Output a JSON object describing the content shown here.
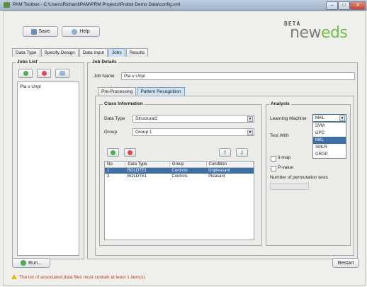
{
  "window": {
    "title": "PAM Toolbox - C:\\Users\\Richard\\PAM\\PRM Projects\\Probol Demo Data\\config.xml",
    "minimize_glyph": "–",
    "maximize_glyph": "□",
    "close_glyph": "✕"
  },
  "toolbar": {
    "save_label": "Save",
    "help_label": "Help"
  },
  "logo": {
    "beta": "BETA",
    "new": "new",
    "eds": "eds"
  },
  "tabs": [
    {
      "label": "Data Type"
    },
    {
      "label": "Specify Design"
    },
    {
      "label": "Data Input"
    },
    {
      "label": "Jobs"
    },
    {
      "label": "Results"
    }
  ],
  "jobs_list": {
    "title": "Jobs List",
    "items": [
      "Pla v Unpl"
    ]
  },
  "job_details": {
    "title": "Job Details",
    "job_name_label": "Job Name",
    "job_name_value": "Pla v Unpl",
    "subtabs": [
      {
        "label": "Pre-Processing"
      },
      {
        "label": "Pattern Recognition"
      }
    ]
  },
  "class_info": {
    "title": "Class Information",
    "data_type_label": "Data Type",
    "data_type_value": "Structural2",
    "group_label": "Group",
    "group_value": "Group 1",
    "columns": [
      "No.",
      "Data Type",
      "Group",
      "Condition"
    ],
    "rows": [
      [
        "1",
        "BOLDTE1",
        "Controls",
        "Unpleasant"
      ],
      [
        "2",
        "BOLDTE1",
        "Controls",
        "Pleasant"
      ]
    ],
    "up_glyph": "⇧",
    "down_glyph": "⇩"
  },
  "analysis": {
    "title": "Analysis",
    "learning_machine_label": "Learning Machine",
    "learning_machine_value": "MKL",
    "options": [
      "SVM",
      "GPC",
      "MKL",
      "SMLR",
      "GRGP"
    ],
    "selected_option": "MKL",
    "test_with_label": "Test With",
    "checkbox_map": "Ii-map",
    "checkbox_pvalue": "P-value",
    "permutation_label": "Number of permutation tests"
  },
  "footer": {
    "run_label": "Run...",
    "restart_label": "Restart",
    "status_message": "The list of associated data files must contain at least 1 item(s)"
  },
  "colors": {
    "accent": "#3e6ea6",
    "brand_green": "#6fbf4a",
    "warning_red": "#c0392b"
  }
}
